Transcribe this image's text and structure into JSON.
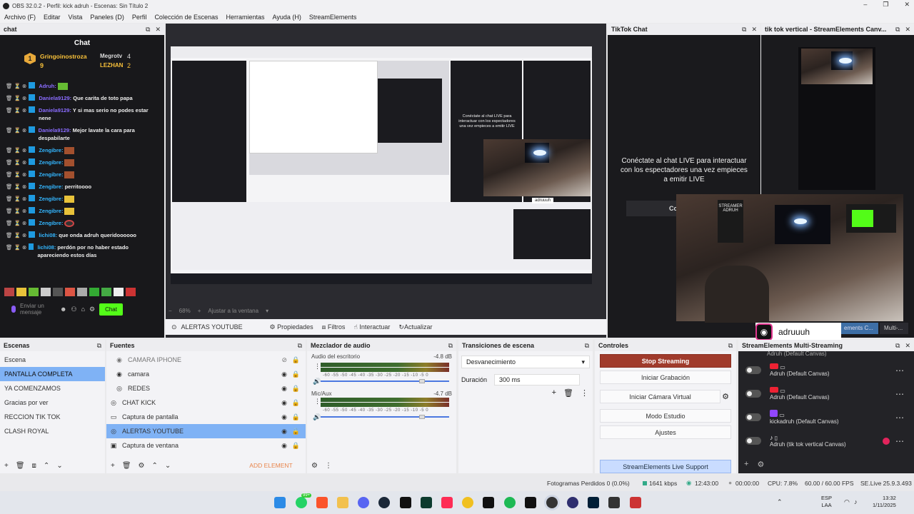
{
  "window": {
    "title": "OBS 32.0.2 - Perfil: kick adruh - Escenas: Sin Título 2"
  },
  "menu": [
    "Archivo (F)",
    "Editar",
    "Vista",
    "Paneles (D)",
    "Perfil",
    "Colección de Escenas",
    "Herramientas",
    "Ayuda (H)",
    "StreamElements"
  ],
  "chat_dock": {
    "title": "chat",
    "header": "Chat",
    "top_user1": "Gringoinostroza",
    "top_user1_count": "9",
    "top_user2": "Megrotv",
    "top_user2_count": "4",
    "top_user3": "LEZHAN",
    "top_user3_count": "2",
    "rank": "1",
    "messages": [
      {
        "user": "Adruh:",
        "text": ""
      },
      {
        "user": "Daniela9129:",
        "text": " Que carita de toto papa"
      },
      {
        "user": "Daniela9129:",
        "text": " Y si mas serio no podes estar nene"
      },
      {
        "user": "Daniela9129:",
        "text": " Mejor lavate la cara para despabilarte"
      },
      {
        "user": "Zengibre:",
        "text": ""
      },
      {
        "user": "Zengibre:",
        "text": ""
      },
      {
        "user": "Zengibre:",
        "text": ""
      },
      {
        "user": "Zengibre:",
        "text": " perritoooo"
      },
      {
        "user": "Zengibre:",
        "text": ""
      },
      {
        "user": "Zengibre:",
        "text": ""
      },
      {
        "user": "Zengibre:",
        "text": ""
      },
      {
        "user": "lichi08:",
        "text": " que onda adruh queridoooooo"
      },
      {
        "user": "lichi08:",
        "text": " perdón por no haber estado apareciendo estos días"
      }
    ],
    "input_placeholder": "Enviar un mensaje",
    "send_label": "Chat"
  },
  "preview": {
    "zoom": "68%",
    "fit_label": "Ajustar a la ventana",
    "mini_chat_text": "Conéctate al chat LIVE para interactuar con los espectadores una vez empieces a emitir LIVE",
    "mini_tiktok_handle": "adruuuh"
  },
  "source_toolbar": {
    "source_name": "ALERTAS YOUTUBE",
    "properties": "Propiedades",
    "filters": "Filtros",
    "interact": "Interactuar",
    "refresh": "Actualizar"
  },
  "tiktok_chat": {
    "title": "TikTok Chat",
    "message": "Conéctate al chat LIVE para interactuar con los espectadores una vez empieces a emitir LIVE",
    "connect_btn": "Co"
  },
  "tiktok_vertical": {
    "title": "tik tok vertical - StreamElements Canv...",
    "handle": "adruuuh",
    "tab1": "ements C...",
    "tab2": "Multi-..."
  },
  "scenes": {
    "title": "Escenas",
    "items": [
      "Escena",
      "PANTALLA COMPLETA",
      "YA COMENZAMOS",
      "Gracias por ver",
      "RECCION TIK TOK",
      "CLASH ROYAL"
    ],
    "selected": 1
  },
  "sources": {
    "title": "Fuentes",
    "items": [
      "CAMARA IPHONE",
      "camara",
      "REDES",
      "CHAT KICK",
      "Captura de pantalla",
      "ALERTAS YOUTUBE",
      "Captura de ventana"
    ],
    "add_element": "ADD ELEMENT"
  },
  "mixer": {
    "title": "Mezclador de audio",
    "ch1_name": "Audio del escritorio",
    "ch1_db": "-4.8 dB",
    "ch2_name": "Mic/Aux",
    "ch2_db": "-4.7 dB",
    "scale": "-60 -55 -50 -45 -40 -35 -30 -25 -20 -15 -10 -5 0"
  },
  "transitions": {
    "title": "Transiciones de escena",
    "selected": "Desvanecimiento",
    "duration_label": "Duración",
    "duration_value": "300 ms"
  },
  "controls": {
    "title": "Controles",
    "stop_streaming": "Stop Streaming",
    "start_recording": "Iniciar Grabación",
    "start_virtual_cam": "Iniciar Cámara Virtual",
    "studio_mode": "Modo Estudio",
    "settings": "Ajustes",
    "support": "StreamElements Live Support"
  },
  "multistream": {
    "title": "StreamElements Multi-Streaming",
    "top_partial": "Adruh (Default Canvas)",
    "rows": [
      {
        "name": "Adruh (Default Canvas)",
        "platform": "youtube"
      },
      {
        "name": "Adruh (Default Canvas)",
        "platform": "youtube"
      },
      {
        "name": "kickadruh (Default Canvas)",
        "platform": "twitch"
      },
      {
        "name": "Adruh (tik tok vertical Canvas)",
        "platform": "tiktok"
      }
    ]
  },
  "status": {
    "dropped": "Fotogramas Perdidos 0 (0.0%)",
    "bitrate": "1641 kbps",
    "stream_time": "12:43:00",
    "rec_time": "00:00:00",
    "cpu": "CPU: 7.8%",
    "fps": "60.00 / 60.00 FPS",
    "version": "SE.Live 25.9.3.493"
  },
  "taskbar": {
    "lang1": "ESP",
    "lang2": "LAA",
    "time": "13:32",
    "date": "1/11/2025",
    "badge": "99+"
  },
  "colors": {
    "accent_selected": "#7fb2f5",
    "stop_streaming": "#a03b2c",
    "chat_bg": "#18181b"
  }
}
